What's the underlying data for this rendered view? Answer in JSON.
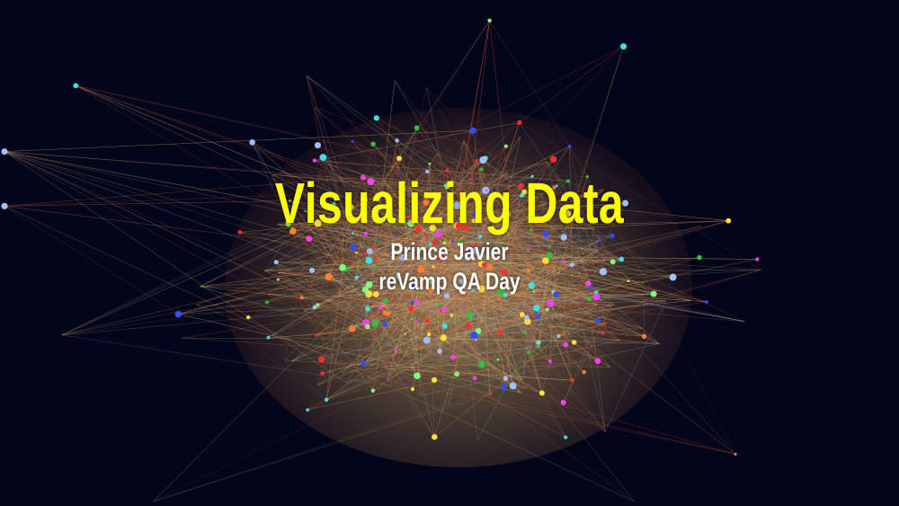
{
  "slide": {
    "title": "Visualizing Data",
    "author": "Prince Javier",
    "event": "reVamp QA Day"
  },
  "colors": {
    "background": "#03051a",
    "title": "#ffff00",
    "subtitle": "#ffffff"
  }
}
